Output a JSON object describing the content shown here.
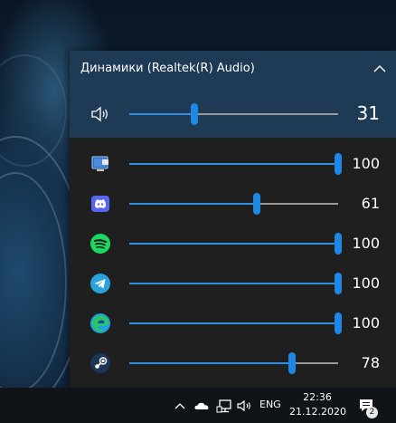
{
  "flyout": {
    "device_name": "Динамики (Realtek(R) Audio)",
    "master": {
      "icon": "speaker-icon",
      "value": "31",
      "level": 0.31
    },
    "apps": [
      {
        "name": "app-system-sounds",
        "icon": "system-sounds-icon",
        "value": "100",
        "level": 1.0
      },
      {
        "name": "app-discord",
        "icon": "discord-icon",
        "value": "61",
        "level": 0.61
      },
      {
        "name": "app-spotify",
        "icon": "spotify-icon",
        "value": "100",
        "level": 1.0
      },
      {
        "name": "app-telegram",
        "icon": "telegram-icon",
        "value": "100",
        "level": 1.0
      },
      {
        "name": "app-edge",
        "icon": "edge-icon",
        "value": "100",
        "level": 1.0
      },
      {
        "name": "app-steam",
        "icon": "steam-icon",
        "value": "78",
        "level": 0.78
      }
    ]
  },
  "taskbar": {
    "language": "ENG",
    "time": "22:36",
    "date": "21.12.2020",
    "notification_count": "2"
  },
  "colors": {
    "accent": "#1e88e5",
    "device_panel": "#1e3a55",
    "flyout_bg": "#1f1f1f",
    "taskbar_bg": "#101418"
  }
}
